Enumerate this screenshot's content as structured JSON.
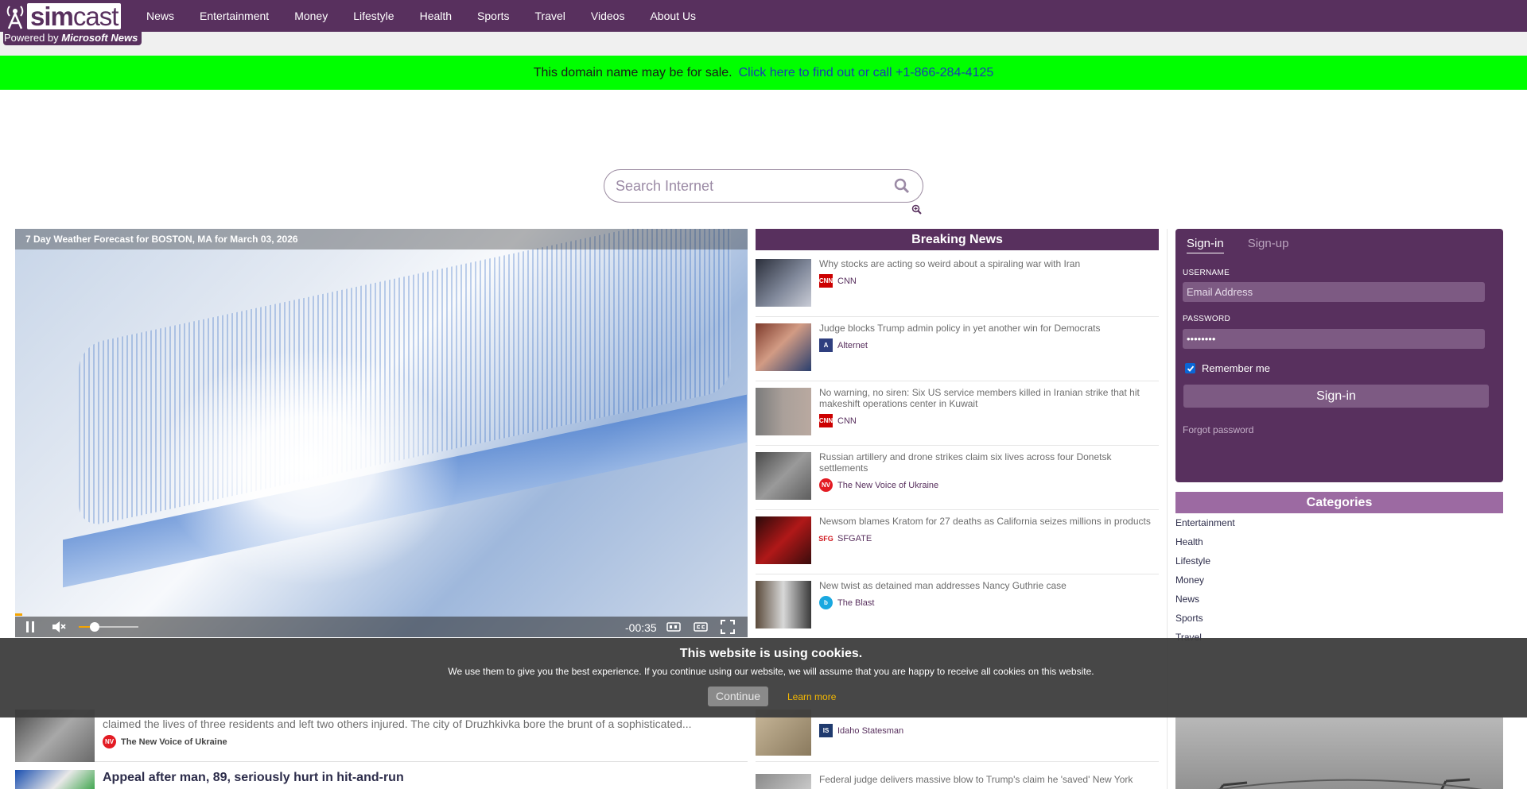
{
  "brand": {
    "logo_text_bold": "sim",
    "logo_text_light": "cast",
    "powered_prefix": "Powered by ",
    "powered_brand": "Microsoft News"
  },
  "nav": {
    "items": [
      {
        "label": "News"
      },
      {
        "label": "Entertainment"
      },
      {
        "label": "Money"
      },
      {
        "label": "Lifestyle"
      },
      {
        "label": "Health"
      },
      {
        "label": "Sports"
      },
      {
        "label": "Travel"
      },
      {
        "label": "Videos"
      },
      {
        "label": "About Us"
      }
    ]
  },
  "sale_banner": {
    "text": "This domain name may be for sale.",
    "link": "Click here to find out or call +1-866-284-4125"
  },
  "search": {
    "placeholder": "Search Internet"
  },
  "video": {
    "title": "7 Day Weather Forecast for BOSTON, MA for March 03, 2026",
    "time_remaining": "-00:35",
    "progress": 0.01,
    "volume": 0.27
  },
  "breaking_news": {
    "title": "Breaking News",
    "items": [
      {
        "title": "Why stocks are acting so weird about a spiraling war with Iran",
        "source": "CNN",
        "source_icon": "cnn-icon"
      },
      {
        "title": "Judge blocks Trump admin policy in yet another win for Democrats",
        "source": "Alternet",
        "source_icon": "alternet-icon"
      },
      {
        "title": "No warning, no siren: Six US service members killed in Iranian strike that hit makeshift operations center in Kuwait",
        "source": "CNN",
        "source_icon": "cnn-icon"
      },
      {
        "title": "Russian artillery and drone strikes claim six lives across four Donetsk settlements",
        "source": "The New Voice of Ukraine",
        "source_icon": "nv-icon"
      },
      {
        "title": "Newsom blames Kratom for 27 deaths as California seizes millions in products",
        "source": "SFGATE",
        "source_icon": "sfgate-icon"
      },
      {
        "title": "New twist as detained man addresses Nancy Guthrie case",
        "source": "The Blast",
        "source_icon": "blast-icon"
      }
    ],
    "item7": {
      "title": "…",
      "source": "Idaho Statesman"
    },
    "item8": {
      "title": "Federal judge delivers massive blow to Trump's claim he 'saved' New York"
    }
  },
  "signin": {
    "tab_signin": "Sign-in",
    "tab_signup": "Sign-up",
    "username_label": "USERNAME",
    "username_placeholder": "Email Address",
    "password_label": "PASSWORD",
    "password_value": "••••••••",
    "remember_label": "Remember me",
    "remember_checked": true,
    "button": "Sign-in",
    "forgot": "Forgot password"
  },
  "categories": {
    "title": "Categories",
    "items": [
      "Entertainment",
      "Health",
      "Lifestyle",
      "Money",
      "News",
      "Sports",
      "Travel"
    ]
  },
  "left_news": {
    "item1": {
      "desc": "claimed the lives of three residents and left two others injured. The city of Druzhkivka bore the brunt of a sophisticated...",
      "source": "The New Voice of Ukraine"
    },
    "item2": {
      "headline": "Appeal after man, 89, seriously hurt in hit-and-run"
    }
  },
  "cookie": {
    "title": "This website is using cookies.",
    "body": "We use them to give you the best experience. If you continue using our website, we will assume that you are happy to receive all cookies on this website.",
    "continue": "Continue",
    "learn_more": "Learn more"
  },
  "colors": {
    "brand_purple": "#58305e",
    "sale_green": "#00ff00",
    "category_header": "#9c6aa2",
    "accent_orange": "#f5a400"
  }
}
